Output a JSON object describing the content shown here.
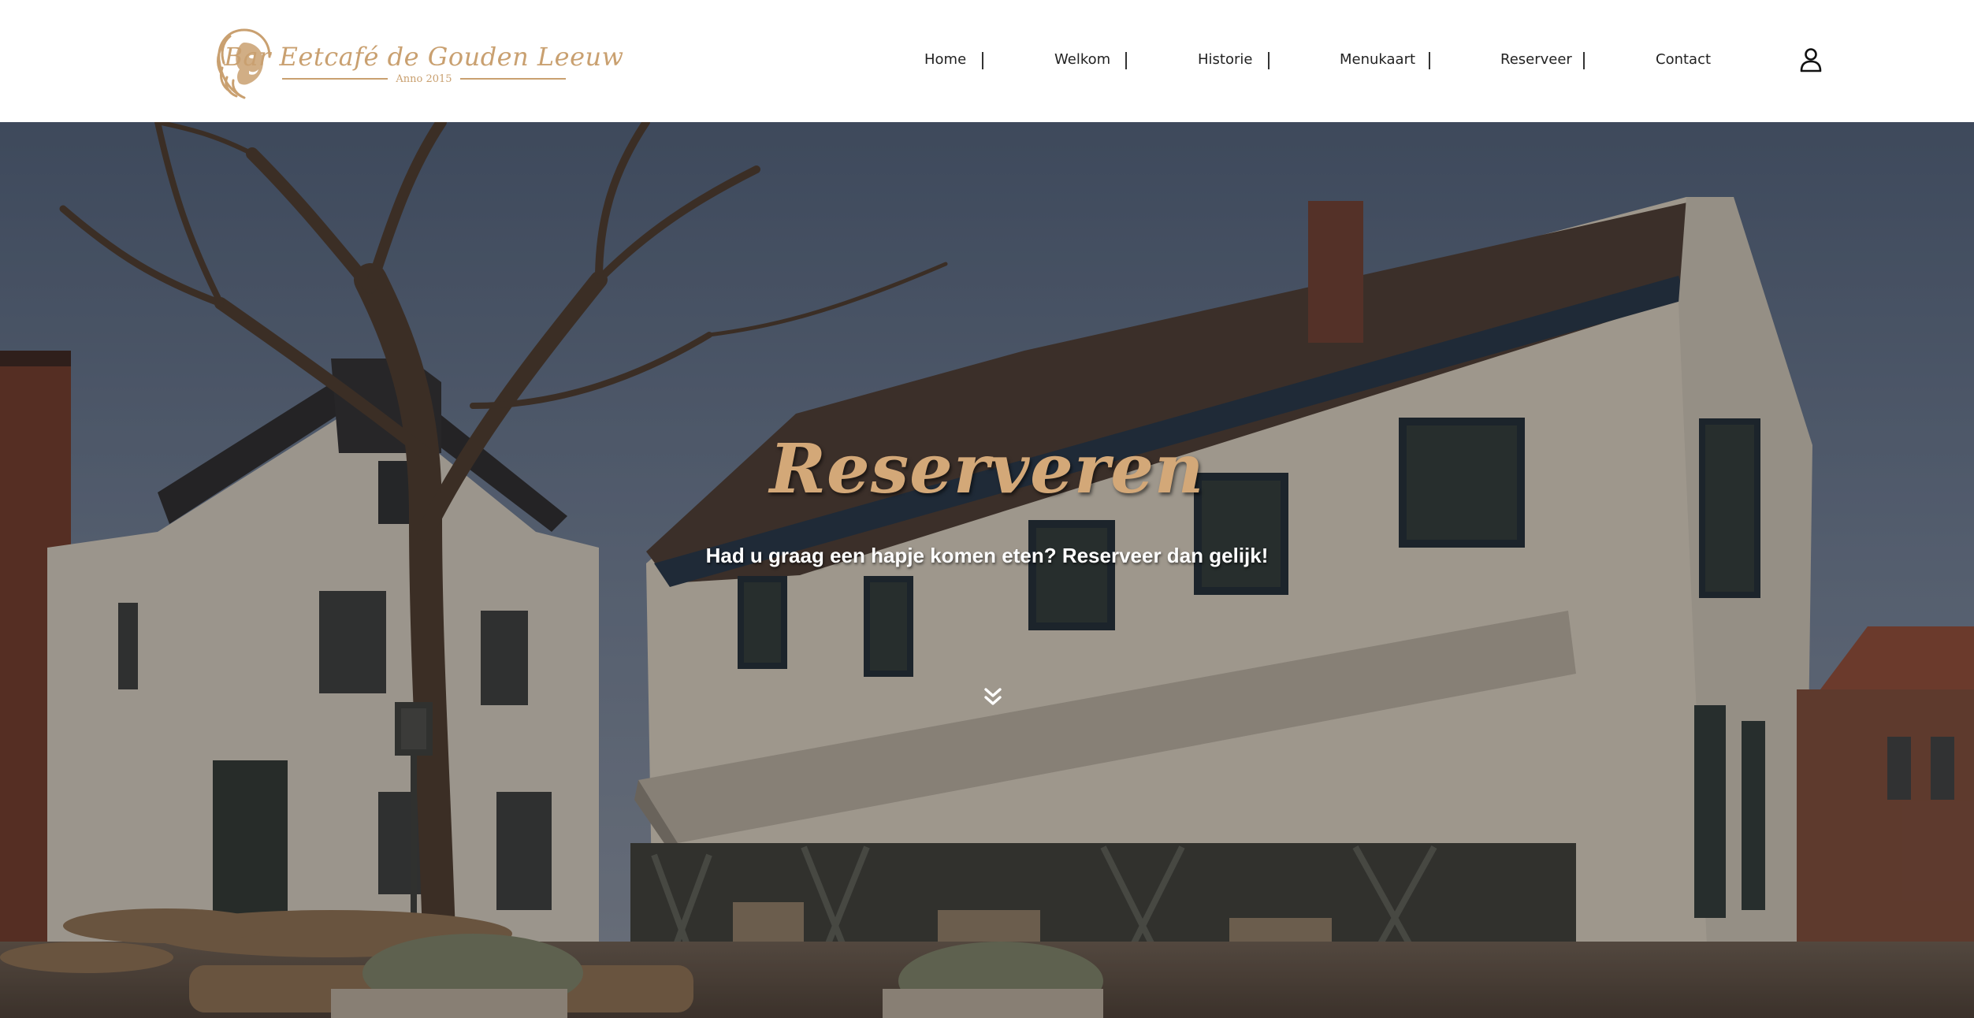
{
  "brand": {
    "name": "Bar  Eetcafé de Gouden Leeuw",
    "tagline": "Anno 2015",
    "logo_icon": "lion-head-icon",
    "accent_color": "#c9a070"
  },
  "nav": {
    "items": [
      {
        "label": "Home"
      },
      {
        "label": "Welkom"
      },
      {
        "label": "Historie"
      },
      {
        "label": "Menukaart"
      },
      {
        "label": "Reserveer"
      },
      {
        "label": "Contact"
      }
    ],
    "account_icon": "user-icon"
  },
  "hero": {
    "title": "Reserveren",
    "subtitle": "Had u graag een hapje komen eten? Reserveer dan gelijk!",
    "scroll_icon": "double-chevron-down-icon",
    "title_color": "#d3a878"
  }
}
